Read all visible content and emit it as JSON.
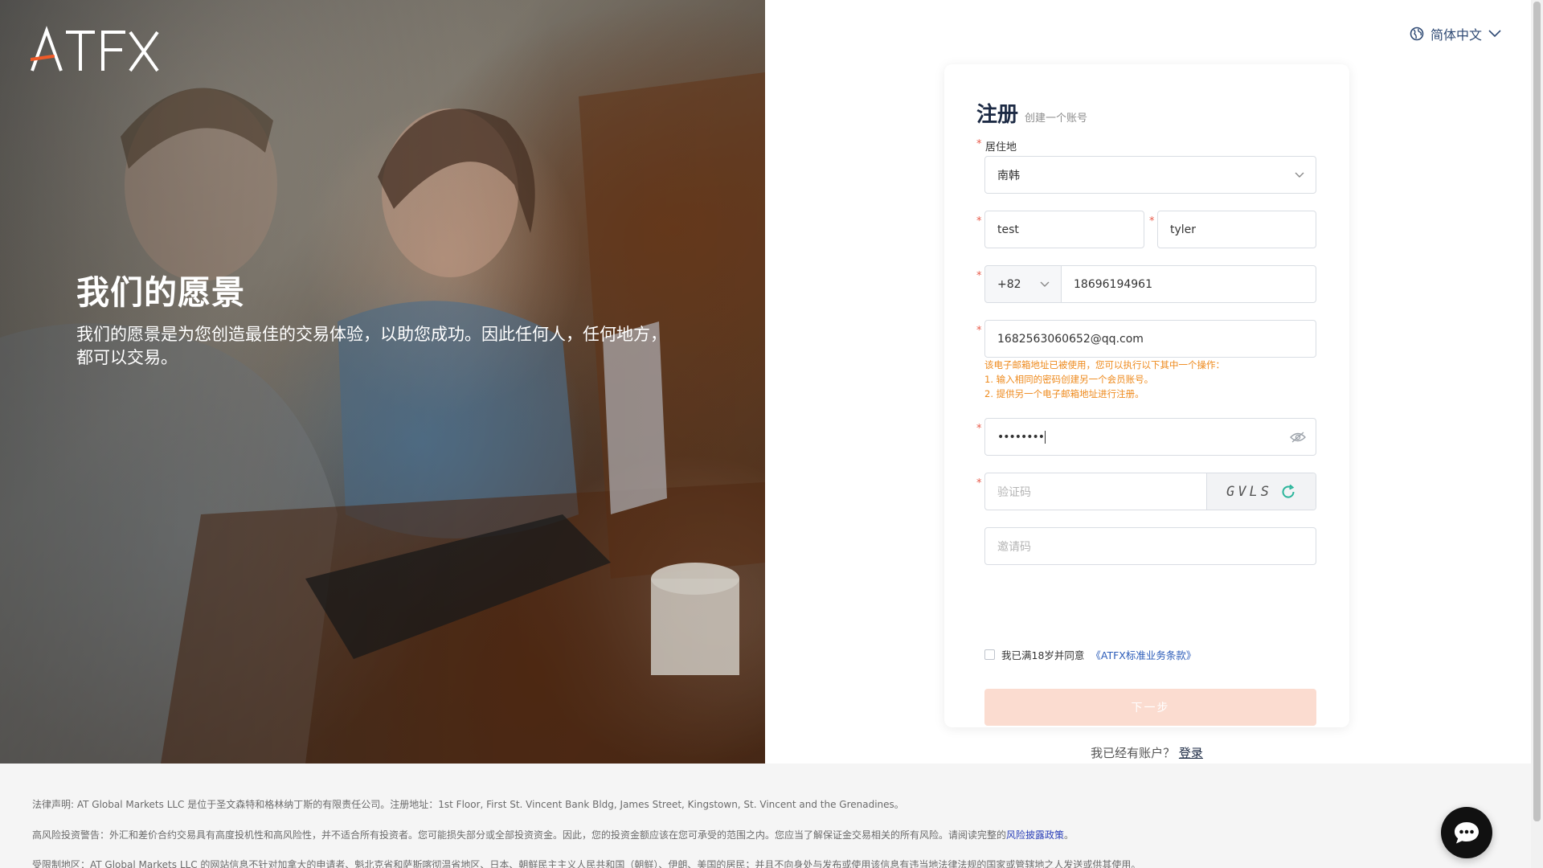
{
  "brand": {
    "logo_text": "ATFX"
  },
  "hero": {
    "title": "我们的愿景",
    "text": "我们的愿景是为您创造最佳的交易体验，以助您成功。因此任何人，任何地方，都可以交易。"
  },
  "language": {
    "label": "简体中文",
    "icon": "globe-icon"
  },
  "form": {
    "title": "注册",
    "subtitle": "创建一个账号",
    "residence_label": "居住地",
    "residence_value": "南韩",
    "first_name": "test",
    "last_name": "tyler",
    "phone_code": "+82",
    "phone_number": "18696194961",
    "email": "1682563060652@qq.com",
    "email_error": [
      "该电子邮箱地址已被使用，您可以执行以下其中一个操作：",
      "1. 输入相同的密码创建另一个会员账号。",
      "2. 提供另一个电子邮箱地址进行注册。"
    ],
    "password_mask": "••••••••",
    "captcha_placeholder": "验证码",
    "captcha_code": "GVLS",
    "invite_placeholder": "邀请码",
    "agree_text": "我已满18岁并同意",
    "agree_link": "《ATFX标准业务条款》",
    "next_button": "下一步",
    "have_account": "我已经有账户？",
    "login_link": "登录"
  },
  "footer": {
    "legal": "法律声明: AT Global Markets LLC 是位于圣文森特和格林纳丁斯的有限责任公司。注册地址：1st Floor, First St. Vincent Bank Bldg, James Street, Kingstown, St. Vincent and the Grenadines。",
    "risk": "高风险投资警告：外汇和差价合约交易具有高度投机性和高风险性，并不适合所有投资者。您可能损失部分或全部投资资金。因此，您的投资金额应该在您可承受的范围之内。您应当了解保证金交易相关的所有风险。请阅读完整的",
    "risk_link": "风险披露政策",
    "risk_end": "。",
    "restricted": "受限制地区：AT Global Markets LLC 的网站信息不针对加拿大的申请者、魁北克省和萨斯喀彻温省地区、日本、朝鲜民主主义人民共和国（朝鲜）、伊朗、美国的居民；并且不向身处与发布或使用该信息有违当地法律法规的国家或管辖地之人发送或供其使用。"
  },
  "colors": {
    "brand_orange": "#f05a28",
    "error_orange": "#ee8a1d",
    "link_blue": "#2a5bb8",
    "button_disabled": "#fbdcd0"
  }
}
